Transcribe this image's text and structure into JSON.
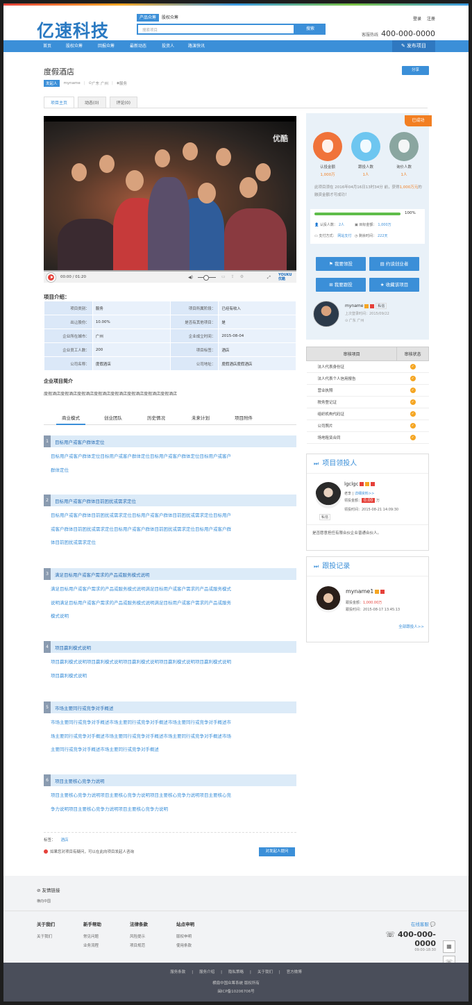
{
  "brand": {
    "logo": "亿速科技"
  },
  "search": {
    "tabs": [
      "产品众筹",
      "股权众筹"
    ],
    "placeholder": "搜索项目",
    "button": "搜索"
  },
  "top": {
    "login": "登录",
    "register": "注册",
    "hotline_label": "客服热线",
    "hotline": "400-000-0000"
  },
  "nav": {
    "items": [
      "首页",
      "股权众筹",
      "回报众筹",
      "最新动态",
      "投资人",
      "路演快讯"
    ],
    "publish": "发布项目"
  },
  "project": {
    "title": "度假酒店",
    "share": "分享",
    "tag": "发起人",
    "owner": "myname",
    "location": "广东 广州",
    "category": "服务"
  },
  "tabs": [
    "项目主页",
    "动态(0)",
    "评论(0)"
  ],
  "video": {
    "logo": "优酷",
    "time": "00:00 / 01:20",
    "brand": "YOUKU 优酷"
  },
  "intro": {
    "heading": "项目介绍：",
    "rows": [
      [
        "项目类别：",
        "服务",
        "项目所属阶段：",
        "已经有收入"
      ],
      [
        "出让股份：",
        "10.00%",
        "是否有其他项目：",
        "是"
      ],
      [
        "企业所在城市：",
        "广州",
        "企业成立时间：",
        "2015-08-04"
      ],
      [
        "企业员工人数：",
        "200",
        "项目标签：",
        "酒店"
      ],
      [
        "公司名称：",
        "度假酒店",
        "公司地址：",
        "度假酒店度假酒店"
      ]
    ],
    "summary_title": "企业项目简介",
    "summary": "度假酒店度假酒店度假酒店度假酒店度假酒店度假酒店度假酒店度假酒店"
  },
  "btabs": [
    "商业模式",
    "创业团队",
    "历史情况",
    "未来计划",
    "项目附件"
  ],
  "sections": [
    {
      "num": "1",
      "title": "目标用户或客户群体定位",
      "lines": [
        "目标用户或客户群体定位目标用户或客户群体定位目标用户或客户群体定位目标用户或客户",
        "群体定位"
      ]
    },
    {
      "num": "2",
      "title": "目标用户或客户群体目前困扰或需求定位",
      "lines": [
        "目标用户或客户群体目前困扰或需求定位目标用户或客户群体目前困扰或需求定位目标用户",
        "或客户群体目前困扰或需求定位目标用户或客户群体目前困扰或需求定位目标用户或客户群",
        "体目前困扰或需求定位"
      ]
    },
    {
      "num": "3",
      "title": "满足目标用户或客户需求的产品或服务模式说明",
      "lines": [
        "满足目标用户或客户需求的产品或服务模式说明满足目标用户或客户需求的产品或服务模式",
        "说明满足目标用户或客户需求的产品或服务模式说明满足目标用户或客户需求的产品或服务",
        "模式说明"
      ]
    },
    {
      "num": "4",
      "title": "项目赢利模式说明",
      "lines": [
        "项目赢利模式说明项目赢利模式说明项目赢利模式说明项目赢利模式说明项目赢利模式说明",
        "项目赢利模式说明"
      ]
    },
    {
      "num": "5",
      "title": "市场主要同行或竞争对手概述",
      "lines": [
        "市场主要同行或竞争对手概述市场主要同行或竞争对手概述市场主要同行或竞争对手概述市",
        "场主要同行或竞争对手概述市场主要同行或竞争对手概述市场主要同行或竞争对手概述市场",
        "主要同行或竞争对手概述市场主要同行或竞争对手概述"
      ]
    },
    {
      "num": "6",
      "title": "项目主要核心竞争力说明",
      "lines": [
        "项目主要核心竞争力说明项目主要核心竞争力说明项目主要核心竞争力说明项目主要核心竞",
        "争力说明项目主要核心竞争力说明项目主要核心竞争力说明"
      ]
    }
  ],
  "tagsrow": {
    "label": "标签：",
    "tag": "酒店"
  },
  "ask": {
    "text": "如果您对项目有疑问，可以在此向项目发起人咨询",
    "button": "对发起人提问"
  },
  "side": {
    "status": "已成功",
    "stats": [
      {
        "label": "认投金额",
        "value": "1,000万"
      },
      {
        "label": "跟投人数",
        "value": "1人"
      },
      {
        "label": "询价人数",
        "value": "1人"
      }
    ],
    "note_a": "此项目须在 2016年04月16日13时34分 前，获得",
    "note_b": "1,000万元",
    "note_c": "的融资金额才可成功！",
    "percent": "100%",
    "raised_label": "认投人数",
    "raised": "2人",
    "target_label": "目标金额",
    "target": "1,000万",
    "pay_label": "支付方式",
    "pay": "网站支付",
    "left_label": "剩余时间",
    "left": "222天",
    "actions": [
      "我要领投",
      "约谈创业者",
      "我要跟投",
      "收藏该项目"
    ],
    "leader": {
      "name": "myname",
      "msg": "私信",
      "last": "上次登录时间：2015/09/22",
      "loc": "广东 广州"
    },
    "audit": {
      "headers": [
        "审核项目",
        "审核状态"
      ],
      "items": [
        "法人代表身份证",
        "法人代表个人信用报告",
        "营业执照",
        "税务登记证",
        "组织机构代码证",
        "公司照片",
        "场地租赁合同"
      ]
    },
    "lead": {
      "title": "项目领投人",
      "name": "lgclgc",
      "link_a": "老李",
      "link_b": "详细资料>>",
      "amount_label": "领投金额：",
      "amount": "0.00",
      "amount_unit": "万",
      "time": "领投时间：2015-08-21 14:09:30",
      "msg": "私信",
      "note": "是否愿意担任有限合伙企业普通合伙人。"
    },
    "follow": {
      "title": "跟投记录",
      "name": "myname1",
      "amount_label": "跟投金额：",
      "amount": "1,000.00万",
      "time": "跟投时间：2015-08-17 13:45:13",
      "all": "全部跟投人>>"
    }
  },
  "footer": {
    "links_title": "友情链接",
    "links_item": "横向中国",
    "cols": [
      {
        "title": "关于我们",
        "items": [
          "关于我们"
        ]
      },
      {
        "title": "新手帮助",
        "items": [
          "常见问题",
          "业务流程"
        ]
      },
      {
        "title": "法律条款",
        "items": [
          "风险提示",
          "项目规范"
        ]
      },
      {
        "title": "站点申明",
        "items": [
          "版权申明",
          "使用条款"
        ]
      }
    ],
    "online": "在线客服",
    "hotline": "400-000-0000",
    "hours": "09:00-18:30",
    "bottom_links": [
      "服务条款",
      "服务介绍",
      "隐私策略",
      "关于我们",
      "官方微博"
    ],
    "copyright": "横扇中国众筹系统  版权所有",
    "icp": "闽ICP备10206706号"
  }
}
